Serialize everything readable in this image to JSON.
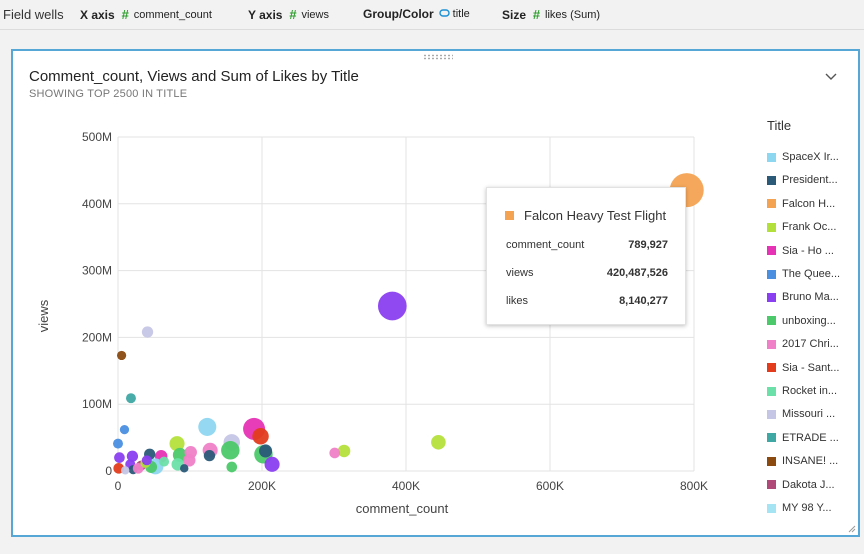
{
  "field_wells": {
    "title": "Field wells",
    "x_axis": {
      "key": "X axis",
      "value": "comment_count"
    },
    "y_axis": {
      "key": "Y axis",
      "value": "views"
    },
    "group": {
      "key": "Group/Color",
      "value": "title"
    },
    "size": {
      "key": "Size",
      "value": "likes (Sum)"
    }
  },
  "visual": {
    "title": "Comment_count, Views and Sum of Likes by Title",
    "subtitle": "SHOWING TOP 2500 IN TITLE"
  },
  "legend": {
    "title": "Title",
    "items": [
      {
        "label": "SpaceX Ir...",
        "color": "#8ed7f0"
      },
      {
        "label": "President...",
        "color": "#2a5a78"
      },
      {
        "label": "Falcon H...",
        "color": "#f4a353"
      },
      {
        "label": "Frank Oc...",
        "color": "#b4e03c"
      },
      {
        "label": "Sia - Ho ...",
        "color": "#e633b5"
      },
      {
        "label": "The Quee...",
        "color": "#4a8fe0"
      },
      {
        "label": "Bruno Ma...",
        "color": "#8a3ff0"
      },
      {
        "label": "unboxing...",
        "color": "#4cc96a"
      },
      {
        "label": "2017 Chri...",
        "color": "#f081c8"
      },
      {
        "label": "Sia - Sant...",
        "color": "#e23c1c"
      },
      {
        "label": "Rocket in...",
        "color": "#6be0a8"
      },
      {
        "label": "Missouri ...",
        "color": "#c5c5e6"
      },
      {
        "label": "ETRADE ...",
        "color": "#40a8a4"
      },
      {
        "label": "INSANE! ...",
        "color": "#8a4a10"
      },
      {
        "label": "Dakota J...",
        "color": "#b04878"
      },
      {
        "label": "MY 98 Y...",
        "color": "#a5e4f2"
      }
    ]
  },
  "tooltip": {
    "title": "Falcon Heavy Test Flight",
    "color": "#f4a353",
    "rows": [
      {
        "label": "comment_count",
        "value": "789,927"
      },
      {
        "label": "views",
        "value": "420,487,526"
      },
      {
        "label": "likes",
        "value": "8,140,277"
      }
    ]
  },
  "chart_data": {
    "type": "scatter",
    "title": "Comment_count, Views and Sum of Likes by Title",
    "subtitle": "SHOWING TOP 2500 IN TITLE",
    "xlabel": "comment_count",
    "ylabel": "views",
    "xlim": [
      0,
      800000
    ],
    "ylim": [
      0,
      500000000
    ],
    "x_ticks": [
      0,
      200000,
      400000,
      600000,
      800000
    ],
    "x_tick_labels": [
      "0",
      "200K",
      "400K",
      "600K",
      "800K"
    ],
    "y_ticks": [
      0,
      100000000,
      200000000,
      300000000,
      400000000,
      500000000
    ],
    "y_tick_labels": [
      "0",
      "100M",
      "200M",
      "300M",
      "400M",
      "500M"
    ],
    "grid": true,
    "legend_position": "right",
    "size_field": "likes (Sum)",
    "points": [
      {
        "title": "Falcon Heavy Test Flight",
        "x": 789927,
        "y": 420487526,
        "size": 8140277,
        "color": "#f4a353"
      },
      {
        "title": "Bruno Ma...",
        "x": 381000,
        "y": 247000000,
        "size": 5800000,
        "color": "#8a3ff0"
      },
      {
        "title": "INSANE! ...",
        "x": 5000,
        "y": 173000000,
        "size": 600000,
        "color": "#8a4a10"
      },
      {
        "title": "Missouri ...",
        "x": 41000,
        "y": 208000000,
        "size": 900000,
        "color": "#c5c5e6"
      },
      {
        "title": "ETRADE ...",
        "x": 18000,
        "y": 109000000,
        "size": 700000,
        "color": "#40a8a4"
      },
      {
        "title": "The Quee...",
        "x": 9000,
        "y": 62000000,
        "size": 600000,
        "color": "#4a8fe0"
      },
      {
        "title": "Frank Oc...",
        "x": 445000,
        "y": 43000000,
        "size": 1500000,
        "color": "#b4e03c"
      },
      {
        "title": "Frank Oc...",
        "x": 314000,
        "y": 30000000,
        "size": 1100000,
        "color": "#b4e03c"
      },
      {
        "title": "2017 Chri...",
        "x": 301000,
        "y": 27000000,
        "size": 800000,
        "color": "#f081c8"
      },
      {
        "title": "Sia - Ho ...",
        "x": 189000,
        "y": 63000000,
        "size": 3400000,
        "color": "#e633b5"
      },
      {
        "title": "Sia - Sant...",
        "x": 198000,
        "y": 52000000,
        "size": 1900000,
        "color": "#e23c1c"
      },
      {
        "title": "SpaceX Ir...",
        "x": 124000,
        "y": 66000000,
        "size": 2300000,
        "color": "#8ed7f0"
      },
      {
        "title": "Missouri ...",
        "x": 158000,
        "y": 43000000,
        "size": 1900000,
        "color": "#c5c5e6"
      },
      {
        "title": "unboxing...",
        "x": 156000,
        "y": 31000000,
        "size": 2400000,
        "color": "#4cc96a"
      },
      {
        "title": "unboxing...",
        "x": 202000,
        "y": 25000000,
        "size": 2400000,
        "color": "#4cc96a"
      },
      {
        "title": "Bruno Ma...",
        "x": 214000,
        "y": 10000000,
        "size": 1600000,
        "color": "#8a3ff0"
      },
      {
        "title": "President...",
        "x": 205000,
        "y": 30000000,
        "size": 1200000,
        "color": "#2a5a78"
      },
      {
        "title": "2017 Chri...",
        "x": 128000,
        "y": 31000000,
        "size": 1600000,
        "color": "#f081c8"
      },
      {
        "title": "President...",
        "x": 127000,
        "y": 23000000,
        "size": 900000,
        "color": "#2a5a78"
      },
      {
        "title": "Frank Oc...",
        "x": 82000,
        "y": 41000000,
        "size": 1600000,
        "color": "#b4e03c"
      },
      {
        "title": "unboxing...",
        "x": 86000,
        "y": 24000000,
        "size": 1400000,
        "color": "#4cc96a"
      },
      {
        "title": "2017 Chri...",
        "x": 101000,
        "y": 28000000,
        "size": 1100000,
        "color": "#f081c8"
      },
      {
        "title": "2017 Chri...",
        "x": 99000,
        "y": 16000000,
        "size": 1100000,
        "color": "#f081c8"
      },
      {
        "title": "Rocket in...",
        "x": 83000,
        "y": 10000000,
        "size": 1100000,
        "color": "#6be0a8"
      },
      {
        "title": "President...",
        "x": 92000,
        "y": 4000000,
        "size": 500000,
        "color": "#2a5a78"
      },
      {
        "title": "unboxing...",
        "x": 158000,
        "y": 6000000,
        "size": 800000,
        "color": "#4cc96a"
      },
      {
        "title": "Sia - Ho ...",
        "x": 60000,
        "y": 22000000,
        "size": 1100000,
        "color": "#e633b5"
      },
      {
        "title": "President...",
        "x": 44000,
        "y": 25000000,
        "size": 900000,
        "color": "#2a5a78"
      },
      {
        "title": "Bruno Ma...",
        "x": 20000,
        "y": 22000000,
        "size": 900000,
        "color": "#8a3ff0"
      },
      {
        "title": "Bruno Ma...",
        "x": 2000,
        "y": 20000000,
        "size": 800000,
        "color": "#8a3ff0"
      },
      {
        "title": "The Quee...",
        "x": 0,
        "y": 41000000,
        "size": 700000,
        "color": "#4a8fe0"
      },
      {
        "title": "SpaceX Ir...",
        "x": 52000,
        "y": 7000000,
        "size": 1800000,
        "color": "#8ed7f0"
      },
      {
        "title": "unboxing...",
        "x": 46000,
        "y": 6000000,
        "size": 1000000,
        "color": "#4cc96a"
      },
      {
        "title": "Dakota J...",
        "x": 32000,
        "y": 8000000,
        "size": 700000,
        "color": "#b04878"
      },
      {
        "title": "Bruno Ma...",
        "x": 17000,
        "y": 10000000,
        "size": 700000,
        "color": "#8a3ff0"
      },
      {
        "title": "Sia - Sant...",
        "x": 1000,
        "y": 4000000,
        "size": 800000,
        "color": "#e23c1c"
      },
      {
        "title": "President...",
        "x": 21000,
        "y": 2000000,
        "size": 600000,
        "color": "#2a5a78"
      },
      {
        "title": "2017 Chri...",
        "x": 28000,
        "y": 4000000,
        "size": 800000,
        "color": "#f081c8"
      },
      {
        "title": "Missouri ...",
        "x": 10000,
        "y": 1000000,
        "size": 500000,
        "color": "#c5c5e6"
      },
      {
        "title": "Frank Oc...",
        "x": 38000,
        "y": 12000000,
        "size": 700000,
        "color": "#b4e03c"
      },
      {
        "title": "Rocket in...",
        "x": 64000,
        "y": 14000000,
        "size": 700000,
        "color": "#6be0a8"
      },
      {
        "title": "Bruno Ma...",
        "x": 40000,
        "y": 16000000,
        "size": 700000,
        "color": "#8a3ff0"
      }
    ]
  }
}
